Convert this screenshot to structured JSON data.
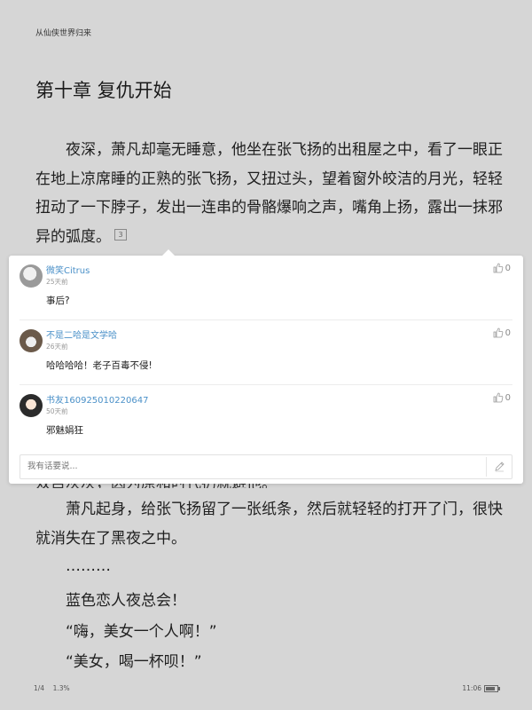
{
  "book_title": "从仙侠世界归来",
  "chapter_title": "第十章 复仇开始",
  "paragraph1": "夜深，萧凡却毫无睡意，他坐在张飞扬的出租屋之中，看了一眼正在地上凉席睡的正熟的张飞扬，又扭过头，望着窗外皎洁的月光，轻轻扭动了一下脖子，发出一连串的骨骼爆响之声，嘴角上扬，露出一抹邪异的弧度。",
  "paragraph1_comment_count": "3",
  "partial_line": "双目灰灰，因为原和时代扔就避他。",
  "paragraph2": "萧凡起身，给张飞扬留了一张纸条，然后就轻轻的打开了门，很快就消失在了黑夜之中。",
  "line_dots": "………",
  "line_blue": "蓝色恋人夜总会！",
  "line_quote1": "“嗨，美女一个人啊！”",
  "line_quote2": "“美女，喝一杯呗！”",
  "comments": [
    {
      "user": "微笑Citrus",
      "time": "25天前",
      "content": "事后?",
      "likes": "0"
    },
    {
      "user": "不是二哈是文学哈",
      "time": "26天前",
      "content": "哈哈哈哈！老子百毒不侵!",
      "likes": "0"
    },
    {
      "user": "书友160925010220647",
      "time": "50天前",
      "content": "邪魅娟狂",
      "likes": "0"
    }
  ],
  "comment_input_placeholder": "我有话要说...",
  "footer": {
    "page": "1/4",
    "progress": "1.3%",
    "time": "11:06",
    "battery_level": 0.8
  },
  "colors": {
    "username": "#4a90c8",
    "background": "#d6d6d6"
  }
}
